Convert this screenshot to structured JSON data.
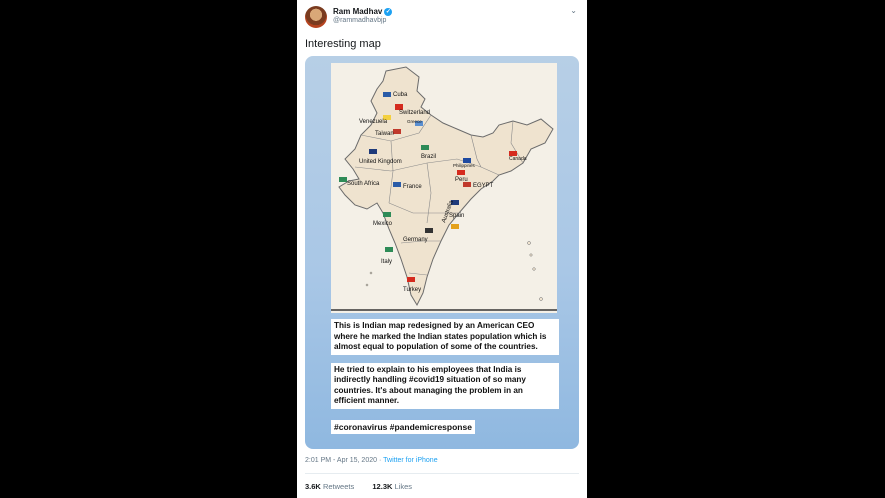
{
  "author": {
    "name": "Ram Madhav",
    "handle": "@rammadhavbjp"
  },
  "tweet": {
    "text": "Interesting map"
  },
  "map": {
    "labels": [
      "Cuba",
      "Switzerland",
      "Venezuela",
      "Greece",
      "Taiwan",
      "Brazil",
      "United Kingdom",
      "Canada",
      "Philippines",
      "Peru",
      "South Africa",
      "France",
      "EGYPT",
      "Australia",
      "Mexico",
      "Spain",
      "Germany",
      "Italy",
      "Turkey"
    ]
  },
  "caption": {
    "paragraph1": "This is Indian map redesigned by an American CEO where he marked the Indian states population which is almost equal to population of some of the countries.",
    "paragraph2": "He tried to explain to his employees that India is indirectly handling #covid19 situation of so many countries. It's about managing the problem in an efficient manner.",
    "hashtags": "#coronavirus #pandemicresponse"
  },
  "meta": {
    "time": "2:01 PM",
    "date": "Apr 15, 2020",
    "source": "Twitter for iPhone"
  },
  "stats": {
    "retweets_count": "3.6K",
    "retweets_label": "Retweets",
    "likes_count": "12.3K",
    "likes_label": "Likes"
  },
  "colors": {
    "verified": "#1da1f2",
    "map_fill": "#efe3cf",
    "map_stroke": "#6b6b6b"
  }
}
